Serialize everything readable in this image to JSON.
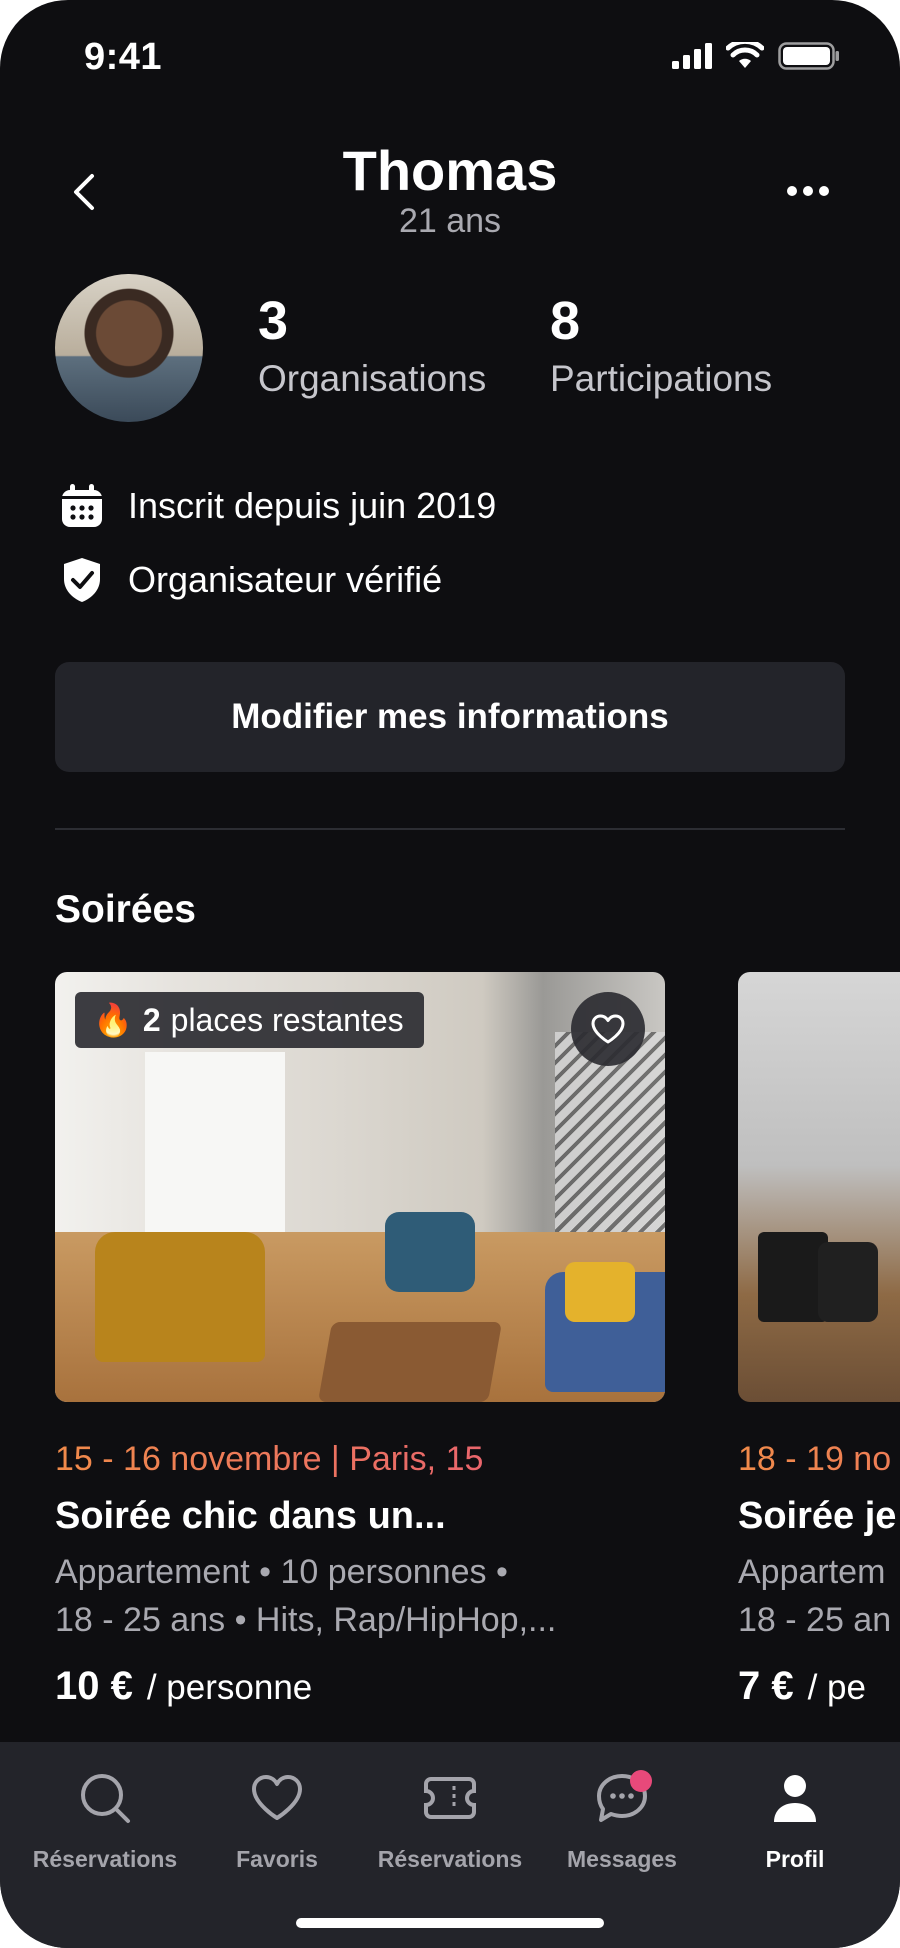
{
  "status_bar": {
    "time": "9:41"
  },
  "header": {
    "title": "Thomas",
    "subtitle": "21 ans"
  },
  "profile": {
    "stats": [
      {
        "value": "3",
        "label": "Organisations"
      },
      {
        "value": "8",
        "label": "Participations"
      }
    ],
    "info": [
      {
        "icon": "calendar-icon",
        "text": "Inscrit depuis juin 2019"
      },
      {
        "icon": "verified-shield-icon",
        "text": "Organisateur vérifié"
      }
    ],
    "edit_label": "Modifier mes informations"
  },
  "section": {
    "title": "Soirées"
  },
  "cards": [
    {
      "badge_icon": "🔥",
      "badge_count": "2",
      "badge_text": "places restantes",
      "date": "15 - 16 novembre | Paris, 15",
      "title": "Soirée chic dans un...",
      "desc_line1": "Appartement • 10 personnes •",
      "desc_line2": "18 - 25 ans • Hits, Rap/HipHop,...",
      "price": "10 €",
      "price_unit": "/ personne"
    },
    {
      "date": "18 - 19 no",
      "title": "Soirée je",
      "desc_line1": "Appartem",
      "desc_line2": "18 - 25 an",
      "price": "7 €",
      "price_unit": "/ pe"
    }
  ],
  "tabbar": {
    "tabs": [
      {
        "label": "Réservations",
        "icon": "search-icon"
      },
      {
        "label": "Favoris",
        "icon": "heart-icon"
      },
      {
        "label": "Réservations",
        "icon": "ticket-icon"
      },
      {
        "label": "Messages",
        "icon": "chat-icon"
      },
      {
        "label": "Profil",
        "icon": "user-icon"
      }
    ]
  },
  "colors": {
    "background": "#0e0e11",
    "surface": "#23242a",
    "accent_from": "#f08b4a",
    "accent_to": "#e6557a",
    "notification": "#e8497a"
  }
}
